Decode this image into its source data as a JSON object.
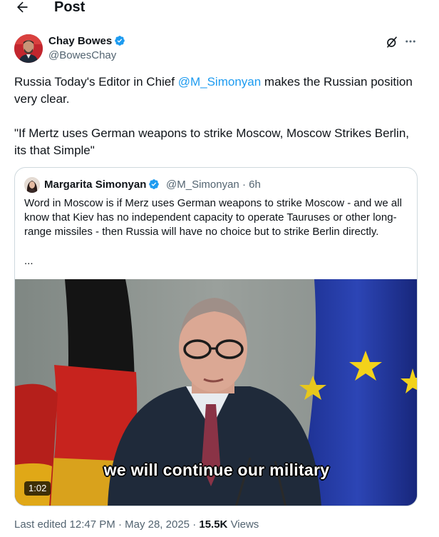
{
  "header": {
    "title": "Post",
    "back_icon": "arrow-left-icon"
  },
  "author": {
    "name": "Chay Bowes",
    "handle": "@BowesChay",
    "verified_icon": "verified-badge-icon",
    "verified_color": "#1d9bf0"
  },
  "actions": {
    "grok_icon": "grok-icon",
    "more_icon": "more-horizontal-icon"
  },
  "tweet": {
    "line1_before": "Russia Today's Editor in Chief ",
    "mention": "@M_Simonyan",
    "line1_after": " makes the Russian position very clear.",
    "quote_text": "\"If Mertz uses German weapons to strike Moscow, Moscow Strikes Berlin, its that Simple\""
  },
  "quoted": {
    "name": "Margarita Simonyan",
    "handle": "@M_Simonyan",
    "separator": "·",
    "time": "6h",
    "text": "Word in Moscow is if Merz uses German weapons to strike Moscow - and we all know that Kiev has no independent capacity to operate Tauruses or other long-range missiles - then Russia will have no choice but to strike Berlin directly.",
    "ellipsis": "...",
    "video": {
      "subtitle": "we will continue our military",
      "duration": "1:02"
    }
  },
  "footer": {
    "edited": "Last edited 12:47 PM",
    "separator": "·",
    "date": "May 28, 2025",
    "views_count": "15.5K",
    "views_label": "Views"
  },
  "colors": {
    "accent": "#1d9bf0",
    "text": "#0f1419",
    "muted": "#536471",
    "border": "#cfd9de"
  }
}
